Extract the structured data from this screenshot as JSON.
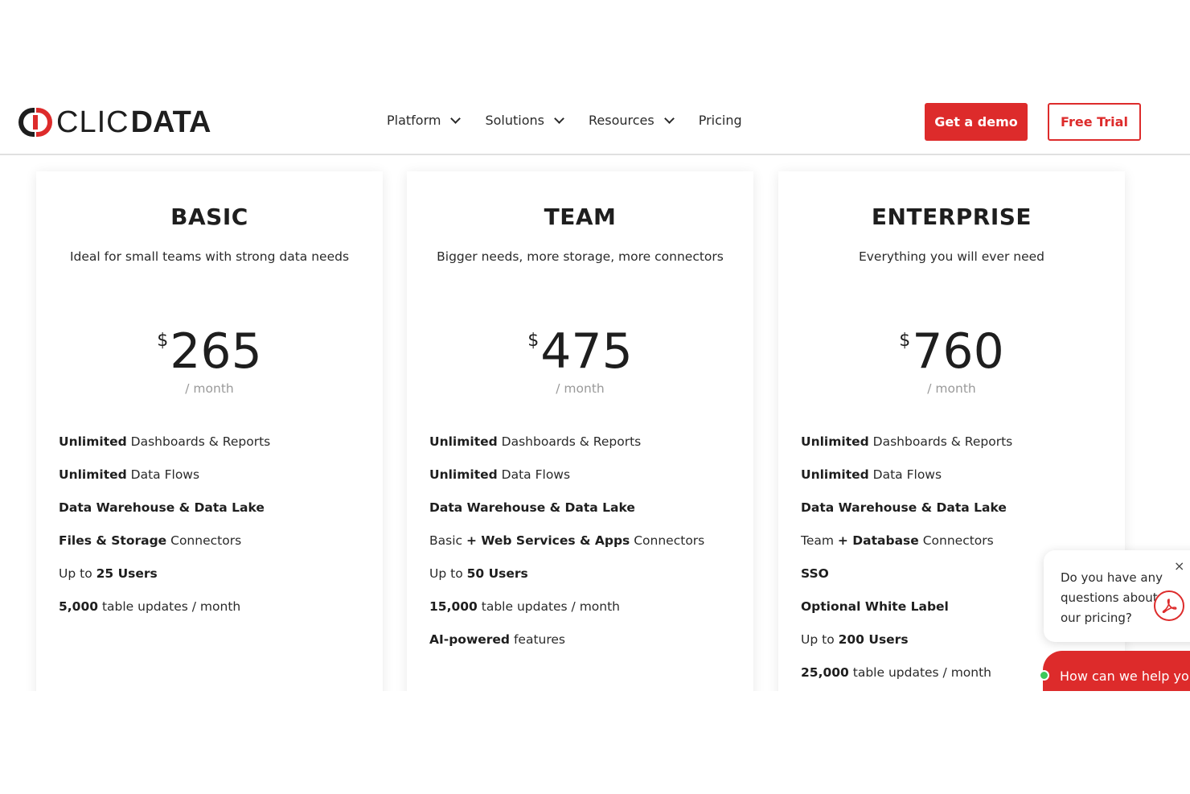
{
  "brand": {
    "logo_part1": "CLIC",
    "logo_part2": "DATA",
    "accent": "#dd2b2b"
  },
  "nav": {
    "items": [
      {
        "label": "Platform",
        "has_dropdown": true
      },
      {
        "label": "Solutions",
        "has_dropdown": true
      },
      {
        "label": "Resources",
        "has_dropdown": true
      },
      {
        "label": "Pricing",
        "has_dropdown": false
      }
    ],
    "demo_label": "Get a demo",
    "trial_label": "Free Trial"
  },
  "plans": [
    {
      "name": "BASIC",
      "tagline": "Ideal for small teams with strong data needs",
      "currency": "$",
      "price": "265",
      "period": "/ month",
      "features": [
        [
          {
            "t": "Unlimited",
            "b": true
          },
          {
            "t": " Dashboards & Reports",
            "b": false
          }
        ],
        [
          {
            "t": "Unlimited",
            "b": true
          },
          {
            "t": " Data Flows",
            "b": false
          }
        ],
        [
          {
            "t": "Data Warehouse & Data Lake",
            "b": true
          }
        ],
        [
          {
            "t": "Files & Storage",
            "b": true
          },
          {
            "t": " Connectors",
            "b": false
          }
        ],
        [
          {
            "t": "Up to ",
            "b": false
          },
          {
            "t": "25 Users",
            "b": true
          }
        ],
        [
          {
            "t": "5,000",
            "b": true
          },
          {
            "t": " table updates / month",
            "b": false
          }
        ]
      ]
    },
    {
      "name": "TEAM",
      "tagline": "Bigger needs, more storage, more connectors",
      "currency": "$",
      "price": "475",
      "period": "/ month",
      "features": [
        [
          {
            "t": "Unlimited",
            "b": true
          },
          {
            "t": " Dashboards & Reports",
            "b": false
          }
        ],
        [
          {
            "t": "Unlimited",
            "b": true
          },
          {
            "t": " Data Flows",
            "b": false
          }
        ],
        [
          {
            "t": "Data Warehouse & Data Lake",
            "b": true
          }
        ],
        [
          {
            "t": "Basic ",
            "b": false
          },
          {
            "t": "+ Web Services & Apps",
            "b": true
          },
          {
            "t": " Connectors",
            "b": false
          }
        ],
        [
          {
            "t": "Up to ",
            "b": false
          },
          {
            "t": "50 Users",
            "b": true
          }
        ],
        [
          {
            "t": "15,000",
            "b": true
          },
          {
            "t": " table updates / month",
            "b": false
          }
        ],
        [
          {
            "t": "AI-powered",
            "b": true
          },
          {
            "t": " features",
            "b": false
          }
        ]
      ]
    },
    {
      "name": "ENTERPRISE",
      "tagline": "Everything you will ever need",
      "currency": "$",
      "price": "760",
      "period": "/ month",
      "features": [
        [
          {
            "t": "Unlimited",
            "b": true
          },
          {
            "t": " Dashboards & Reports",
            "b": false
          }
        ],
        [
          {
            "t": "Unlimited",
            "b": true
          },
          {
            "t": " Data Flows",
            "b": false
          }
        ],
        [
          {
            "t": "Data Warehouse & Data Lake",
            "b": true
          }
        ],
        [
          {
            "t": "Team ",
            "b": false
          },
          {
            "t": "+ Database",
            "b": true
          },
          {
            "t": " Connectors",
            "b": false
          }
        ],
        [
          {
            "t": "SSO",
            "b": true
          }
        ],
        [
          {
            "t": "Optional White Label",
            "b": true
          }
        ],
        [
          {
            "t": "Up to ",
            "b": false
          },
          {
            "t": "200 Users",
            "b": true
          }
        ],
        [
          {
            "t": "25,000",
            "b": true
          },
          {
            "t": " table updates / month",
            "b": false
          }
        ]
      ]
    }
  ],
  "chat": {
    "question": "Do you have any questions about our pricing?",
    "close_icon": "×",
    "pdf_icon": "pdf-icon",
    "bar_label": "How can we help you?",
    "status_color": "#3cc85a"
  }
}
